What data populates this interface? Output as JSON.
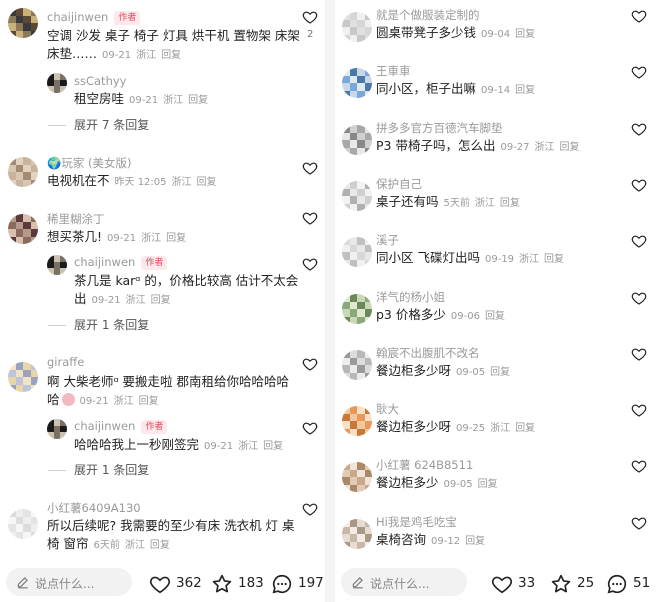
{
  "left": {
    "comments": [
      {
        "name": "chaijinwen",
        "author_tag": "作者",
        "lines": [
          "空调 沙发 桌子 椅子 灯具 烘干机 置物架 床架",
          "床垫……"
        ],
        "time": "09-21",
        "loc": "浙江",
        "reply": "回复",
        "likes": "2",
        "replies": [
          {
            "name": "ssCathyy",
            "text": "租空房哇",
            "time": "09-21",
            "loc": "浙江",
            "reply": "回复"
          }
        ],
        "more": "展开 7 条回复"
      },
      {
        "name": "🌍玩家 (美女版)",
        "lines": [
          "电视机在不"
        ],
        "time": "昨天 12:05",
        "loc": "浙江",
        "reply": "回复"
      },
      {
        "name": "稀里糊涂丁",
        "lines": [
          "想买茶几!"
        ],
        "time": "09-21",
        "loc": "浙江",
        "reply": "回复",
        "replies": [
          {
            "name": "chaijinwen",
            "author_tag": "作者",
            "lines": [
              "茶几是 karᵅ 的，价格比较高 估计不太会",
              "出"
            ],
            "time": "09-21",
            "loc": "浙江",
            "reply": "回复"
          }
        ],
        "more": "展开 1 条回复"
      },
      {
        "name": "giraffe",
        "lines": [
          "啊 大柴老师ᵅ 要搬走啦 郡南租给你哈哈哈哈",
          "哈"
        ],
        "time": "09-21",
        "loc": "浙江",
        "reply": "回复",
        "replies": [
          {
            "name": "chaijinwen",
            "author_tag": "作者",
            "text": "哈哈哈我上一秒刚签完",
            "time": "09-21",
            "loc": "浙江",
            "reply": "回复"
          }
        ],
        "more": "展开 1 条回复"
      },
      {
        "name": "小红薯6409A130",
        "lines": [
          "所以后续呢? 我需要的至少有床 洗衣机 灯 桌",
          "椅  窗帘"
        ],
        "time": "6天前",
        "loc": "浙江",
        "reply": "回复"
      }
    ],
    "bar": {
      "placeholder": "说点什么...",
      "likes": "362",
      "stars": "183",
      "comments": "197"
    }
  },
  "right": {
    "comments": [
      {
        "name": "就是个做服装定制的",
        "text": "圆桌带凳子多少钱",
        "time": "09-04",
        "reply": "回复"
      },
      {
        "name": "王車車",
        "text": "同小区，柜子出嘛",
        "time": "09-14",
        "reply": "回复"
      },
      {
        "name": "拼多多官方百德汽车脚垫",
        "text": "P3 带椅子吗，怎么出",
        "time": "09-27",
        "loc": "浙江",
        "reply": "回复"
      },
      {
        "name": "保护自己",
        "text": "桌子还有吗",
        "time": "5天前",
        "loc": "浙江",
        "reply": "回复"
      },
      {
        "name": "溪子",
        "text": "同小区 飞碟灯出吗",
        "time": "09-19",
        "loc": "浙江",
        "reply": "回复"
      },
      {
        "name": "洋气的杨小姐",
        "text": "p3 价格多少",
        "time": "09-06",
        "reply": "回复"
      },
      {
        "name": "翰宸不出腹肌不改名",
        "text": "餐边柜多少呀",
        "time": "09-05",
        "reply": "回复"
      },
      {
        "name": "耿大",
        "text": "餐边柜多少呀",
        "time": "09-25",
        "loc": "浙江",
        "reply": "回复"
      },
      {
        "name": "小红薯 624B8511",
        "text": "餐边柜多少",
        "time": "09-05",
        "reply": "回复"
      },
      {
        "name": "Hi我是鸡毛吃宝",
        "text": "桌椅咨询",
        "time": "09-12",
        "reply": "回复"
      }
    ],
    "bar": {
      "placeholder": "说点什么...",
      "likes": "33",
      "stars": "25",
      "comments": "51"
    }
  },
  "colors": {
    "author_tag": "#e8455a",
    "meta": "#9a9a9a"
  }
}
